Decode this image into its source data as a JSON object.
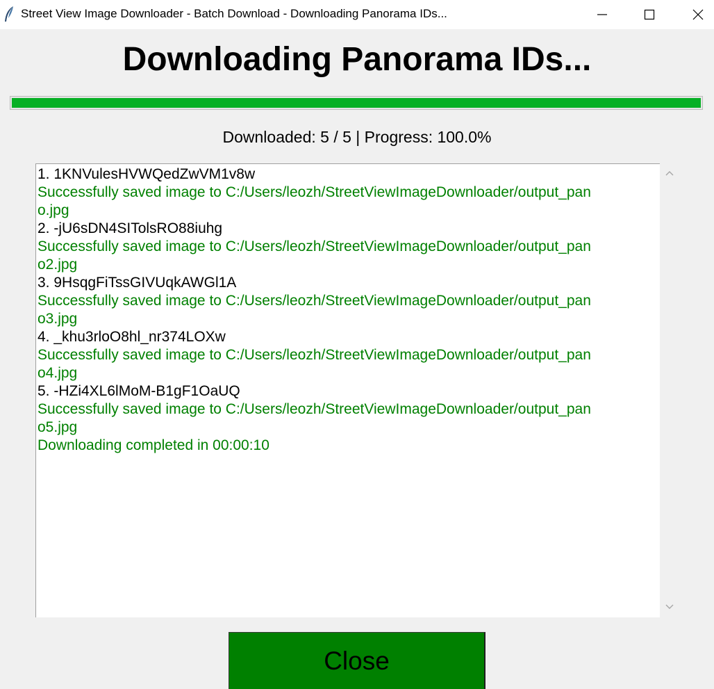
{
  "window": {
    "title": "Street View Image Downloader - Batch Download - Downloading Panorama IDs..."
  },
  "heading": "Downloading Panorama IDs...",
  "progress": {
    "percent": 100.0,
    "fill_color": "#06b025"
  },
  "status": "Downloaded: 5 / 5 | Progress: 100.0%",
  "log": {
    "lines": [
      {
        "text": "1. 1KNVulesHVWQedZwVM1v8w",
        "kind": "id"
      },
      {
        "text": "Successfully saved image to C:/Users/leozh/StreetViewImageDownloader/output_pan",
        "kind": "ok"
      },
      {
        "text": "o.jpg",
        "kind": "ok"
      },
      {
        "text": "2. -jU6sDN4SITolsRO88iuhg",
        "kind": "id"
      },
      {
        "text": "Successfully saved image to C:/Users/leozh/StreetViewImageDownloader/output_pan",
        "kind": "ok"
      },
      {
        "text": "o2.jpg",
        "kind": "ok"
      },
      {
        "text": "3. 9HsqgFiTssGIVUqkAWGl1A",
        "kind": "id"
      },
      {
        "text": "Successfully saved image to C:/Users/leozh/StreetViewImageDownloader/output_pan",
        "kind": "ok"
      },
      {
        "text": "o3.jpg",
        "kind": "ok"
      },
      {
        "text": "4. _khu3rloO8hl_nr374LOXw",
        "kind": "id"
      },
      {
        "text": "Successfully saved image to C:/Users/leozh/StreetViewImageDownloader/output_pan",
        "kind": "ok"
      },
      {
        "text": "o4.jpg",
        "kind": "ok"
      },
      {
        "text": "5. -HZi4XL6lMoM-B1gF1OaUQ",
        "kind": "id"
      },
      {
        "text": "Successfully saved image to C:/Users/leozh/StreetViewImageDownloader/output_pan",
        "kind": "ok"
      },
      {
        "text": "o5.jpg",
        "kind": "ok"
      },
      {
        "text": "Downloading completed in 00:00:10",
        "kind": "ok"
      }
    ],
    "success_color": "#008000"
  },
  "close_button": {
    "label": "Close",
    "color": "#008000"
  },
  "icons": {
    "app": "feather-icon",
    "minimize": "minimize-icon",
    "maximize": "maximize-icon",
    "close": "close-icon",
    "scroll_up": "chevron-up-icon",
    "scroll_down": "chevron-down-icon"
  }
}
